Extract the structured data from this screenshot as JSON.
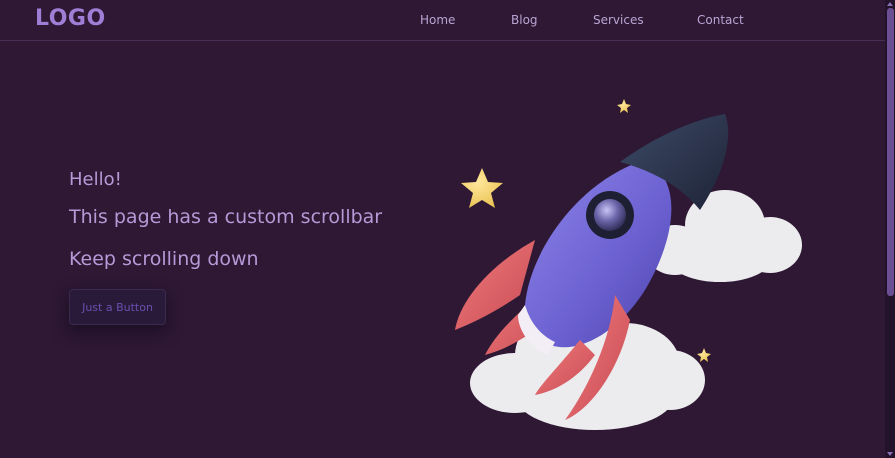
{
  "nav": {
    "logo": "LOGO",
    "links": [
      "Home",
      "Blog",
      "Services",
      "Contact"
    ]
  },
  "hero": {
    "line1": "Hello!",
    "line2": "This page has a custom scrollbar",
    "line3": "Keep scrolling down",
    "button_label": "Just a Button"
  },
  "illustration": {
    "icon": "rocket-illustration",
    "stars": [
      "star-icon",
      "star-icon",
      "star-icon"
    ],
    "clouds": [
      "cloud-icon",
      "cloud-icon"
    ]
  },
  "colors": {
    "background": "#2e1834",
    "accent": "#9d7fd6",
    "text": "#b49ad6",
    "scroll_thumb": "#6b4f95"
  }
}
